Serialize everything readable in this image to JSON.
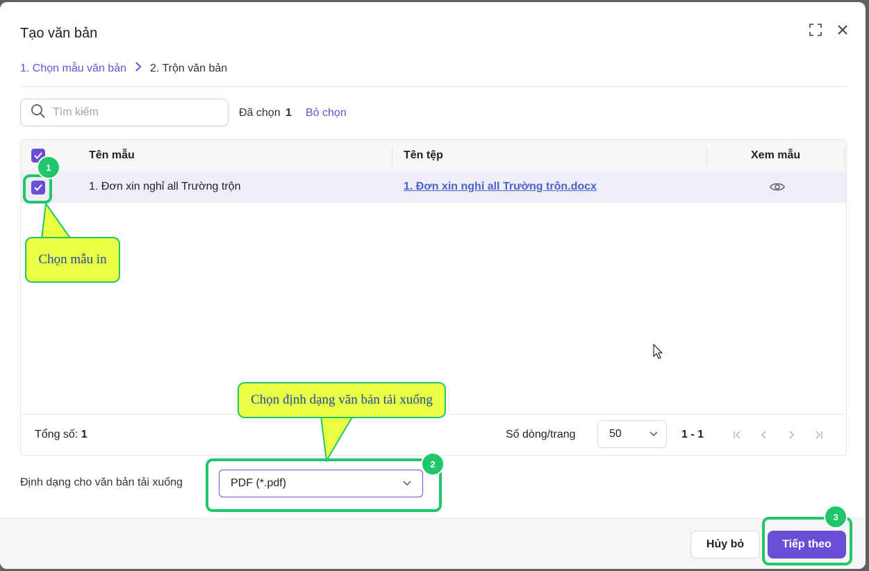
{
  "dialog": {
    "title": "Tạo văn bản",
    "expand_icon": "expand-icon",
    "close_icon": "close-icon"
  },
  "steps": {
    "step1": "1. Chọn mẫu văn bản",
    "step2": "2. Trộn văn bản"
  },
  "search": {
    "placeholder": "Tìm kiếm"
  },
  "selection": {
    "label": "Đã chọn",
    "count": "1",
    "deselect": "Bỏ chọn"
  },
  "table": {
    "columns": [
      "Tên mẫu",
      "Tên tệp",
      "Xem mẫu"
    ],
    "rows": [
      {
        "template_name": "1. Đơn xin nghỉ all Trường trộn",
        "file_name": "1. Đơn xin nghỉ all Trường trộn.docx",
        "checked": true
      }
    ],
    "footer": {
      "total_label": "Tổng số:",
      "total_value": "1",
      "rows_per_page_label": "Số dòng/trang",
      "rows_per_page_value": "50",
      "range": "1 - 1"
    }
  },
  "format": {
    "label": "Định dạng cho văn bản tải xuống",
    "value": "PDF (*.pdf)"
  },
  "buttons": {
    "cancel": "Hủy bỏ",
    "next": "Tiếp theo"
  },
  "annotations": {
    "badge1": "1",
    "badge2": "2",
    "badge3": "3",
    "callout1": "Chọn mẫu in",
    "callout2": "Chọn định dạng văn bản tải xuống",
    "color": "#1fc76a",
    "callout_fill": "#e8ff44"
  },
  "colors": {
    "accent": "#6a4fd6",
    "link": "#4a63c9"
  }
}
